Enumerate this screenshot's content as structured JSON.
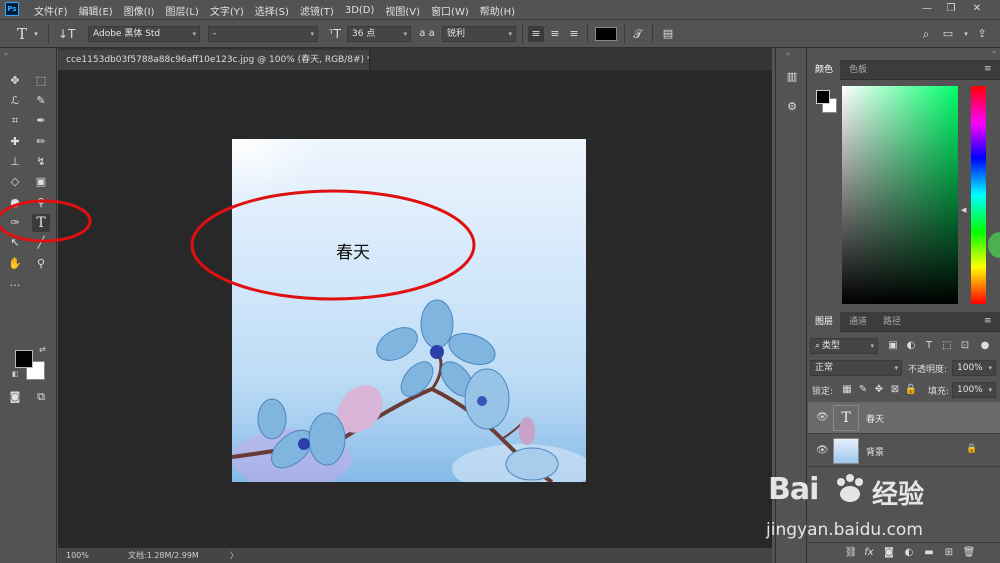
{
  "app": {
    "logo": "Ps"
  },
  "menus": [
    "文件(F)",
    "编辑(E)",
    "图像(I)",
    "图层(L)",
    "文字(Y)",
    "选择(S)",
    "滤镜(T)",
    "3D(D)",
    "视图(V)",
    "窗口(W)",
    "帮助(H)"
  ],
  "options": {
    "font_family": "Adobe 黑体 Std",
    "font_style": "-",
    "font_size": "36 点",
    "aa_label": "a a",
    "antialias": "锐利"
  },
  "document": {
    "tab_title": "cce1153db03f5788a88c96aff10e123c.jpg @ 100% (春天, RGB/8#) *",
    "canvas_text": "春天",
    "zoom": "100%",
    "doc_info": "文档:1.28M/2.99M"
  },
  "color_panel": {
    "tabs": [
      "颜色",
      "色板"
    ]
  },
  "layers_panel": {
    "tabs": [
      "图层",
      "通道",
      "路径"
    ],
    "filter_label": "类型",
    "blend_mode": "正常",
    "opacity_label": "不透明度:",
    "opacity_value": "100%",
    "lock_label": "锁定:",
    "fill_label": "填充:",
    "fill_value": "100%",
    "layers": [
      {
        "name": "春天",
        "type": "text",
        "selected": true
      },
      {
        "name": "背景",
        "type": "image",
        "locked": true
      }
    ]
  },
  "watermark": {
    "brand": "Bai",
    "brand2": "经验",
    "url": "jingyan.baidu.com"
  },
  "colors": {
    "ui_bg": "#535353",
    "canvas_bg": "#282828",
    "annotation_red": "#e01010",
    "foreground": "#000000",
    "background": "#ffffff"
  }
}
